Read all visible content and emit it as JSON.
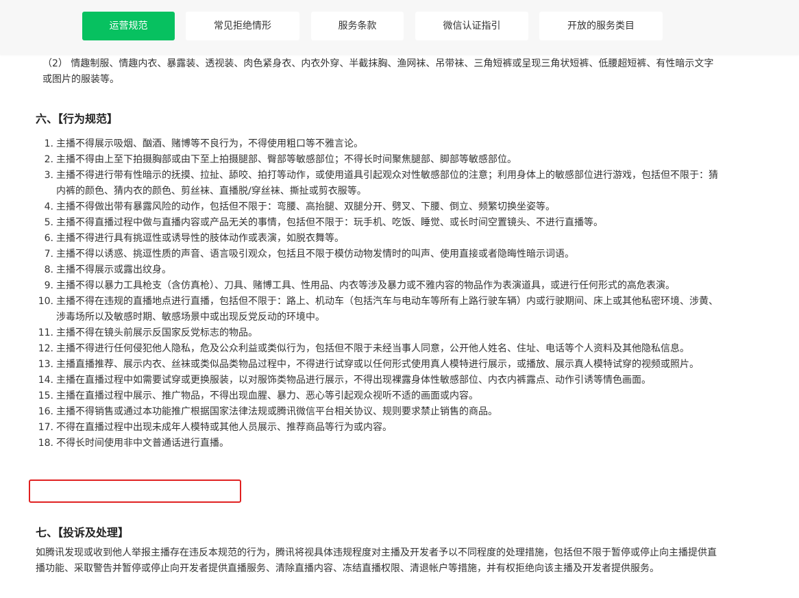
{
  "nav": {
    "tabs": [
      {
        "label": "运营规范",
        "active": true
      },
      {
        "label": "常见拒绝情形",
        "active": false
      },
      {
        "label": "服务条款",
        "active": false
      },
      {
        "label": "微信认证指引",
        "active": false
      },
      {
        "label": "开放的服务类目",
        "active": false
      }
    ]
  },
  "content": {
    "intro_para": "（2） 情趣制服、情趣内衣、暴露装、透视装、肉色紧身衣、内衣外穿、半截抹胸、渔网袜、吊带袜、三角短裤或呈现三角状短裤、低腰超短裤、有性暗示文字或图片的服装等。",
    "section6_title": "六、【行为规范】",
    "rules": [
      {
        "num": "1.",
        "text": "主播不得展示吸烟、酗酒、赌博等不良行为，不得使用粗口等不雅言论。"
      },
      {
        "num": "2.",
        "text": "主播不得由上至下拍摄胸部或由下至上拍摄腿部、臀部等敏感部位；不得长时间聚焦腿部、脚部等敏感部位。"
      },
      {
        "num": "3.",
        "text": "主播不得进行带有性暗示的抚摸、拉扯、舔咬、拍打等动作，或使用道具引起观众对性敏感部位的注意；利用身体上的敏感部位进行游戏，包括但不限于：猜内裤的颜色、猜内衣的颜色、剪丝袜、直播脱/穿丝袜、撕扯或剪衣服等。"
      },
      {
        "num": "4.",
        "text": "主播不得做出带有暴露风险的动作，包括但不限于：弯腰、高抬腿、双腿分开、劈叉、下腰、倒立、频繁切换坐姿等。"
      },
      {
        "num": "5.",
        "text": "主播不得直播过程中做与直播内容或产品无关的事情，包括但不限于：玩手机、吃饭、睡觉、或长时间空置镜头、不进行直播等。"
      },
      {
        "num": "6.",
        "text": "主播不得进行具有挑逗性或诱导性的肢体动作或表演，如脱衣舞等。"
      },
      {
        "num": "7.",
        "text": "主播不得以诱惑、挑逗性质的声音、语言吸引观众，包括且不限于模仿动物发情时的叫声、使用直接或者隐晦性暗示词语。"
      },
      {
        "num": "8.",
        "text": "主播不得展示或露出纹身。"
      },
      {
        "num": "9.",
        "text": "主播不得以暴力工具枪支（含仿真枪）、刀具、赌博工具、性用品、内衣等涉及暴力或不雅内容的物品作为表演道具，或进行任何形式的高危表演。"
      },
      {
        "num": "10.",
        "text": "主播不得在违规的直播地点进行直播，包括但不限于：路上、机动车（包括汽车与电动车等所有上路行驶车辆）内或行驶期间、床上或其他私密环境、涉黄、涉毒场所以及敏感时期、敏感场景中或出现反党反动的环境中。"
      },
      {
        "num": "11.",
        "text": "主播不得在镜头前展示反国家反党标志的物品。"
      },
      {
        "num": "12.",
        "text": "主播不得进行任何侵犯他人隐私，危及公众利益或类似行为，包括但不限于未经当事人同意，公开他人姓名、住址、电话等个人资料及其他隐私信息。"
      },
      {
        "num": "13.",
        "text": "主播直播推荐、展示内衣、丝袜或类似品类物品过程中，不得进行试穿或以任何形式使用真人模特进行展示，或播放、展示真人模特试穿的视频或照片。"
      },
      {
        "num": "14.",
        "text": "主播在直播过程中如需要试穿或更换服装，以对服饰类物品进行展示，不得出现裸露身体性敏感部位、内衣内裤露点、动作引诱等情色画面。"
      },
      {
        "num": "15.",
        "text": "主播在直播过程中展示、推广物品，不得出现血腥、暴力、恶心等引起观众视听不适的画面或内容。"
      },
      {
        "num": "16.",
        "text": "主播不得销售或通过本功能推广根据国家法律法规或腾讯微信平台相关协议、规则要求禁止销售的商品。"
      },
      {
        "num": "17.",
        "text": "不得在直播过程中出现未成年人模特或其他人员展示、推荐商品等行为或内容。"
      },
      {
        "num": "18.",
        "text": "不得长时间使用非中文普通话进行直播。"
      }
    ],
    "section7_title": "七、【投诉及处理】",
    "section7_para": "如腾讯发现或收到他人举报主播存在违反本规范的行为，腾讯将视具体违规程度对主播及开发者予以不同程度的处理措施，包括但不限于暂停或停止向主播提供直播功能、采取警告并暂停或停止向开发者提供直播服务、清除直播内容、冻结直播权限、清退帐户等措施，并有权拒绝向该主播及开发者提供服务。"
  },
  "colors": {
    "accent": "#07c160",
    "highlight_border": "#e02020",
    "nav_background": "#f7f7f7"
  }
}
